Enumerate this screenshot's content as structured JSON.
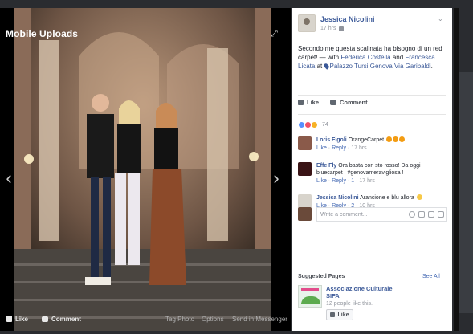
{
  "stage": {
    "title": "Mobile Uploads",
    "bottom_bar": {
      "like": "Like",
      "comment": "Comment",
      "tag_photo": "Tag Photo",
      "options": "Options",
      "send": "Send in Messenger"
    }
  },
  "post": {
    "author": "Jessica Nicolini",
    "time": "17 hrs",
    "text_main": "Secondo me questa scalinata ha bisogno di un red carpet! — with ",
    "tag1": "Federica Costella",
    "and": " and ",
    "tag2": "Francesca Licata",
    "at": " at ",
    "place": "Palazzo Tursi Genova Via Garibaldi",
    "period": "."
  },
  "actions": {
    "like": "Like",
    "comment": "Comment"
  },
  "reactions": {
    "count": "74"
  },
  "comments": [
    {
      "name": "Loris Figoli",
      "text": "OrangeCarpet",
      "like": "Like",
      "reply": "Reply",
      "time": "17 hrs",
      "likes": ""
    },
    {
      "name": "Effe Fly",
      "text": "Ora basta con sto rosso! Da oggi bluecarpet ! #genovameravigliosa !",
      "like": "Like",
      "reply": "Reply",
      "likes": "1",
      "time": "17 hrs"
    },
    {
      "name": "Jessica Nicolini",
      "text": "Arancione e blu allora",
      "like": "Like",
      "reply": "Reply",
      "likes": "2",
      "time": "10 hrs"
    }
  ],
  "write": {
    "placeholder": "Write a comment..."
  },
  "suggested": {
    "title": "Suggested Pages",
    "see_all": "See All",
    "page_name": "Associazione Culturale SIFA",
    "count": "12 people like this.",
    "like": "Like"
  },
  "colors": {
    "link": "#3b5998",
    "stage": "#000000"
  }
}
